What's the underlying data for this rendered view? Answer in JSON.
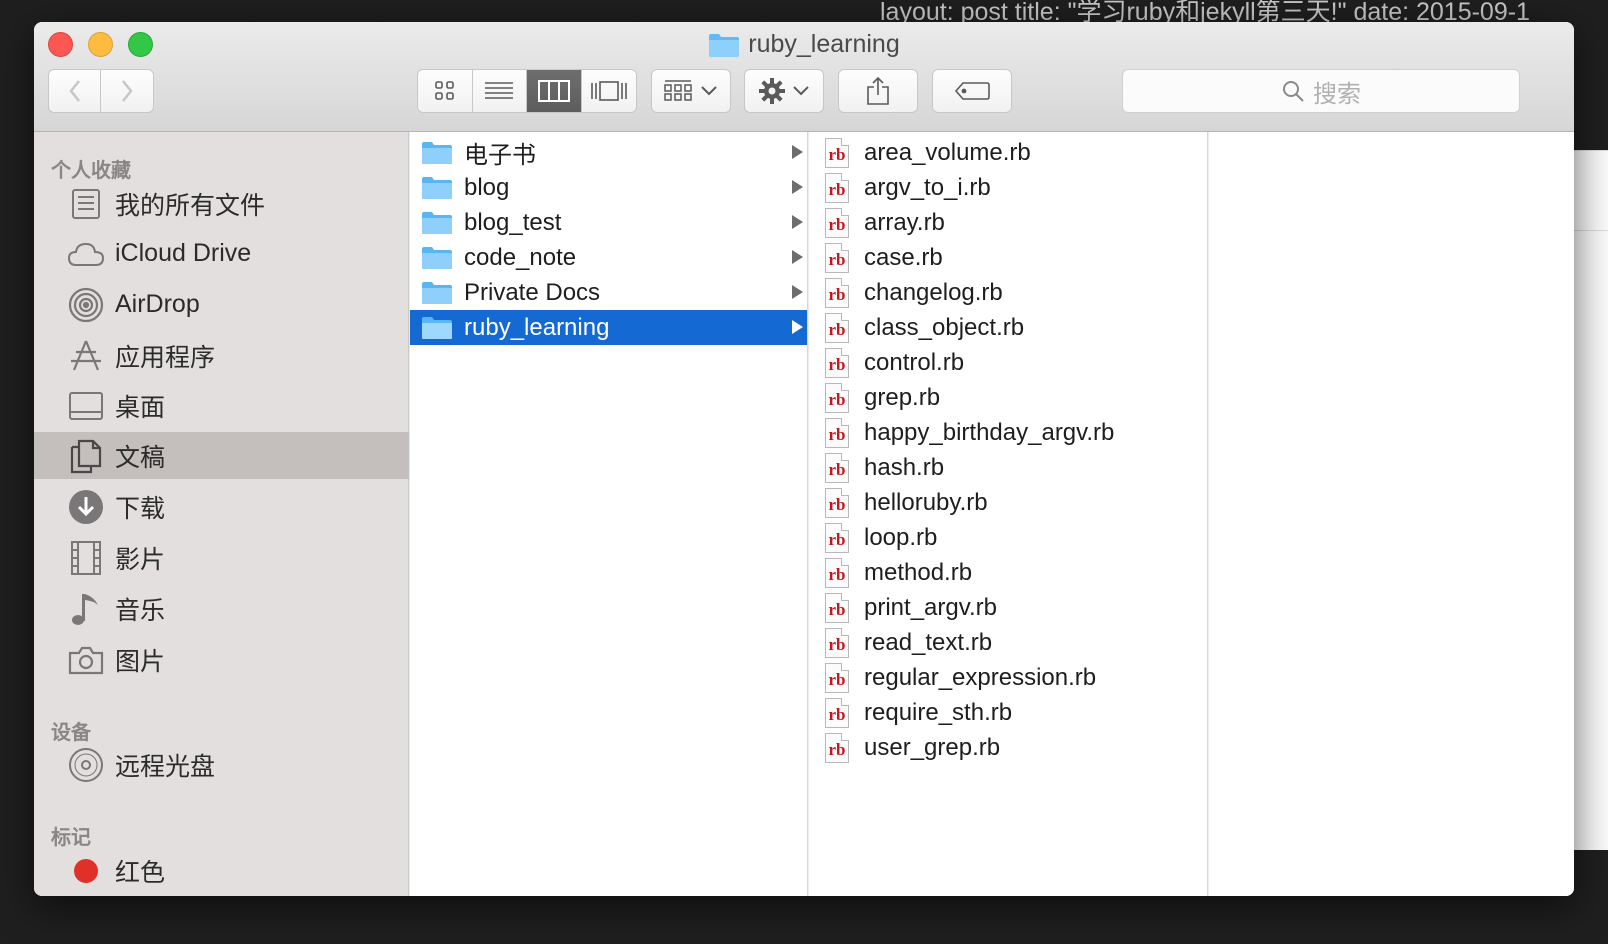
{
  "background_text": "layout: post title: \"学习ruby和jekyll第三天!\" date: 2015-09-1",
  "window": {
    "title": "ruby_learning",
    "search_placeholder": "搜索"
  },
  "sidebar": {
    "favorites_header": "个人收藏",
    "favorites": [
      {
        "label": "我的所有文件",
        "icon": "all-files-icon"
      },
      {
        "label": "iCloud Drive",
        "icon": "cloud-icon"
      },
      {
        "label": "AirDrop",
        "icon": "airdrop-icon"
      },
      {
        "label": "应用程序",
        "icon": "applications-icon"
      },
      {
        "label": "桌面",
        "icon": "desktop-icon"
      },
      {
        "label": "文稿",
        "icon": "documents-icon",
        "selected": true
      },
      {
        "label": "下载",
        "icon": "downloads-icon"
      },
      {
        "label": "影片",
        "icon": "movies-icon"
      },
      {
        "label": "音乐",
        "icon": "music-icon"
      },
      {
        "label": "图片",
        "icon": "pictures-icon"
      }
    ],
    "devices_header": "设备",
    "devices": [
      {
        "label": "远程光盘",
        "icon": "disc-icon"
      }
    ],
    "tags_header": "标记",
    "tags": [
      {
        "label": "红色",
        "color": "#e0302a"
      }
    ]
  },
  "column1": [
    {
      "name": "电子书"
    },
    {
      "name": "blog"
    },
    {
      "name": "blog_test"
    },
    {
      "name": "code_note"
    },
    {
      "name": "Private Docs"
    },
    {
      "name": "ruby_learning",
      "selected": true
    }
  ],
  "column2": [
    {
      "name": "area_volume.rb"
    },
    {
      "name": "argv_to_i.rb"
    },
    {
      "name": "array.rb"
    },
    {
      "name": "case.rb"
    },
    {
      "name": "changelog.rb"
    },
    {
      "name": "class_object.rb"
    },
    {
      "name": "control.rb"
    },
    {
      "name": "grep.rb"
    },
    {
      "name": "happy_birthday_argv.rb"
    },
    {
      "name": "hash.rb"
    },
    {
      "name": "helloruby.rb"
    },
    {
      "name": "loop.rb"
    },
    {
      "name": "method.rb"
    },
    {
      "name": "print_argv.rb"
    },
    {
      "name": "read_text.rb"
    },
    {
      "name": "regular_expression.rb"
    },
    {
      "name": "require_sth.rb"
    },
    {
      "name": "user_grep.rb"
    }
  ],
  "file_badge": "rb",
  "colors": {
    "selection": "#1569d2",
    "sidebar_selection": "#c4bebd",
    "folder": "#5ab6f2",
    "ruby_badge": "#c4161c"
  }
}
